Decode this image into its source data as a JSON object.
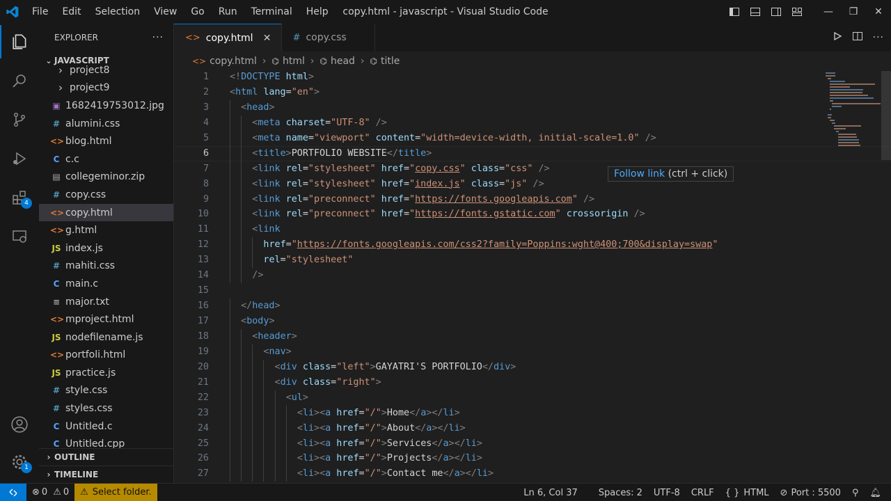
{
  "window": {
    "title": "copy.html - javascript - Visual Studio Code",
    "menus": [
      "File",
      "Edit",
      "Selection",
      "View",
      "Go",
      "Run",
      "Terminal",
      "Help"
    ]
  },
  "activity_bar": {
    "extensions_badge": "4",
    "manage_badge": "1"
  },
  "sidebar": {
    "header": "EXPLORER",
    "more": "···",
    "folder": "JAVASCRIPT",
    "items": [
      {
        "icon": "folder-chevron",
        "label": "project8",
        "glyph": "›",
        "color": "#cccccc"
      },
      {
        "icon": "folder-chevron",
        "label": "project9",
        "glyph": "›",
        "color": "#cccccc"
      },
      {
        "icon": "image-file-icon",
        "label": "1682419753012.jpg",
        "glyph": "▣",
        "color": "#a074c4"
      },
      {
        "icon": "css-file-icon",
        "label": "alumini.css",
        "glyph": "#",
        "color": "#519aba"
      },
      {
        "icon": "html-file-icon",
        "label": "blog.html",
        "glyph": "<>",
        "color": "#e37933"
      },
      {
        "icon": "c-file-icon",
        "label": "c.c",
        "glyph": "C",
        "color": "#599eff"
      },
      {
        "icon": "zip-file-icon",
        "label": "collegeminor.zip",
        "glyph": "▤",
        "color": "#aaaaaa"
      },
      {
        "icon": "css-file-icon",
        "label": "copy.css",
        "glyph": "#",
        "color": "#519aba"
      },
      {
        "icon": "html-file-icon",
        "label": "copy.html",
        "glyph": "<>",
        "color": "#e37933",
        "selected": true
      },
      {
        "icon": "html-file-icon",
        "label": "g.html",
        "glyph": "<>",
        "color": "#e37933"
      },
      {
        "icon": "js-file-icon",
        "label": "index.js",
        "glyph": "JS",
        "color": "#cbcb41"
      },
      {
        "icon": "css-file-icon",
        "label": "mahiti.css",
        "glyph": "#",
        "color": "#519aba"
      },
      {
        "icon": "c-file-icon",
        "label": "main.c",
        "glyph": "C",
        "color": "#599eff"
      },
      {
        "icon": "text-file-icon",
        "label": "major.txt",
        "glyph": "≡",
        "color": "#aaaaaa"
      },
      {
        "icon": "html-file-icon",
        "label": "mproject.html",
        "glyph": "<>",
        "color": "#e37933"
      },
      {
        "icon": "js-file-icon",
        "label": "nodefilename.js",
        "glyph": "JS",
        "color": "#cbcb41"
      },
      {
        "icon": "html-file-icon",
        "label": "portfoli.html",
        "glyph": "<>",
        "color": "#e37933"
      },
      {
        "icon": "js-file-icon",
        "label": "practice.js",
        "glyph": "JS",
        "color": "#cbcb41"
      },
      {
        "icon": "css-file-icon",
        "label": "style.css",
        "glyph": "#",
        "color": "#519aba"
      },
      {
        "icon": "css-file-icon",
        "label": "styles.css",
        "glyph": "#",
        "color": "#519aba"
      },
      {
        "icon": "c-file-icon",
        "label": "Untitled.c",
        "glyph": "C",
        "color": "#599eff"
      },
      {
        "icon": "c-file-icon",
        "label": "Untitled.cpp",
        "glyph": "C",
        "color": "#599eff"
      }
    ],
    "outline": "OUTLINE",
    "timeline": "TIMELINE"
  },
  "tabs": [
    {
      "label": "copy.html",
      "icon": "<>",
      "icon_color": "#e37933",
      "active": true,
      "close": "✕"
    },
    {
      "label": "copy.css",
      "icon": "#",
      "icon_color": "#519aba",
      "active": false,
      "close": ""
    }
  ],
  "breadcrumb": [
    "copy.html",
    "html",
    "head",
    "title"
  ],
  "hover": {
    "link": "Follow link",
    "hint": "(ctrl + click)"
  },
  "code_lines": [
    {
      "n": "1",
      "indent": 0,
      "tokens": [
        [
          "t",
          "<!"
        ],
        [
          "tag",
          "DOCTYPE"
        ],
        [
          "pl",
          " "
        ],
        [
          "at",
          "html"
        ],
        [
          "t",
          ">"
        ]
      ]
    },
    {
      "n": "2",
      "indent": 0,
      "tokens": [
        [
          "t",
          "<"
        ],
        [
          "tag",
          "html"
        ],
        [
          "pl",
          " "
        ],
        [
          "at",
          "lang"
        ],
        [
          "pl",
          "="
        ],
        [
          "str",
          "\"en\""
        ],
        [
          "t",
          ">"
        ]
      ]
    },
    {
      "n": "3",
      "indent": 1,
      "tokens": [
        [
          "t",
          "<"
        ],
        [
          "tag",
          "head"
        ],
        [
          "t",
          ">"
        ]
      ]
    },
    {
      "n": "4",
      "indent": 2,
      "tokens": [
        [
          "t",
          "<"
        ],
        [
          "tag",
          "meta"
        ],
        [
          "pl",
          " "
        ],
        [
          "at",
          "charset"
        ],
        [
          "pl",
          "="
        ],
        [
          "str",
          "\"UTF-8\""
        ],
        [
          "pl",
          " "
        ],
        [
          "t",
          "/>"
        ]
      ]
    },
    {
      "n": "5",
      "indent": 2,
      "tokens": [
        [
          "t",
          "<"
        ],
        [
          "tag",
          "meta"
        ],
        [
          "pl",
          " "
        ],
        [
          "at",
          "name"
        ],
        [
          "pl",
          "="
        ],
        [
          "str",
          "\"viewport\""
        ],
        [
          "pl",
          " "
        ],
        [
          "at",
          "content"
        ],
        [
          "pl",
          "="
        ],
        [
          "str",
          "\"width=device-width, initial-scale=1.0\""
        ],
        [
          "pl",
          " "
        ],
        [
          "t",
          "/>"
        ]
      ]
    },
    {
      "n": "6",
      "indent": 2,
      "cur": true,
      "tokens": [
        [
          "t",
          "<"
        ],
        [
          "tag",
          "title"
        ],
        [
          "t",
          ">"
        ],
        [
          "pl",
          "PORTFOLIO WEBSITE"
        ],
        [
          "t",
          "</"
        ],
        [
          "tag",
          "title"
        ],
        [
          "t",
          ">"
        ]
      ]
    },
    {
      "n": "7",
      "indent": 2,
      "tokens": [
        [
          "t",
          "<"
        ],
        [
          "tag",
          "link"
        ],
        [
          "pl",
          " "
        ],
        [
          "at",
          "rel"
        ],
        [
          "pl",
          "="
        ],
        [
          "str",
          "\"stylesheet\""
        ],
        [
          "pl",
          " "
        ],
        [
          "at",
          "href"
        ],
        [
          "pl",
          "="
        ],
        [
          "str",
          "\""
        ],
        [
          "lstr",
          "copy.css"
        ],
        [
          "str",
          "\""
        ],
        [
          "pl",
          " "
        ],
        [
          "at",
          "class"
        ],
        [
          "pl",
          "="
        ],
        [
          "str",
          "\"css\""
        ],
        [
          "pl",
          " "
        ],
        [
          "t",
          "/>"
        ]
      ]
    },
    {
      "n": "8",
      "indent": 2,
      "tokens": [
        [
          "t",
          "<"
        ],
        [
          "tag",
          "link"
        ],
        [
          "pl",
          " "
        ],
        [
          "at",
          "rel"
        ],
        [
          "pl",
          "="
        ],
        [
          "str",
          "\"stylesheet\""
        ],
        [
          "pl",
          " "
        ],
        [
          "at",
          "href"
        ],
        [
          "pl",
          "="
        ],
        [
          "str",
          "\""
        ],
        [
          "lstr",
          "index.js"
        ],
        [
          "str",
          "\""
        ],
        [
          "pl",
          " "
        ],
        [
          "at",
          "class"
        ],
        [
          "pl",
          "="
        ],
        [
          "str",
          "\"js\""
        ],
        [
          "pl",
          " "
        ],
        [
          "t",
          "/>"
        ]
      ]
    },
    {
      "n": "9",
      "indent": 2,
      "tokens": [
        [
          "t",
          "<"
        ],
        [
          "tag",
          "link"
        ],
        [
          "pl",
          " "
        ],
        [
          "at",
          "rel"
        ],
        [
          "pl",
          "="
        ],
        [
          "str",
          "\"preconnect\""
        ],
        [
          "pl",
          " "
        ],
        [
          "at",
          "href"
        ],
        [
          "pl",
          "="
        ],
        [
          "str",
          "\""
        ],
        [
          "lstr",
          "https://fonts.googleapis.com"
        ],
        [
          "str",
          "\""
        ],
        [
          "pl",
          " "
        ],
        [
          "t",
          "/>"
        ]
      ]
    },
    {
      "n": "10",
      "indent": 2,
      "tokens": [
        [
          "t",
          "<"
        ],
        [
          "tag",
          "link"
        ],
        [
          "pl",
          " "
        ],
        [
          "at",
          "rel"
        ],
        [
          "pl",
          "="
        ],
        [
          "str",
          "\"preconnect\""
        ],
        [
          "pl",
          " "
        ],
        [
          "at",
          "href"
        ],
        [
          "pl",
          "="
        ],
        [
          "str",
          "\""
        ],
        [
          "lstr",
          "https://fonts.gstatic.com"
        ],
        [
          "str",
          "\""
        ],
        [
          "pl",
          " "
        ],
        [
          "at",
          "crossorigin"
        ],
        [
          "pl",
          " "
        ],
        [
          "t",
          "/>"
        ]
      ]
    },
    {
      "n": "11",
      "indent": 2,
      "tokens": [
        [
          "t",
          "<"
        ],
        [
          "tag",
          "link"
        ]
      ]
    },
    {
      "n": "12",
      "indent": 3,
      "tokens": [
        [
          "at",
          "href"
        ],
        [
          "pl",
          "="
        ],
        [
          "str",
          "\""
        ],
        [
          "lstr",
          "https://fonts.googleapis.com/css2?family=Poppins:wght@400;700&display=swap"
        ],
        [
          "str",
          "\""
        ]
      ]
    },
    {
      "n": "13",
      "indent": 3,
      "tokens": [
        [
          "at",
          "rel"
        ],
        [
          "pl",
          "="
        ],
        [
          "str",
          "\"stylesheet\""
        ]
      ]
    },
    {
      "n": "14",
      "indent": 2,
      "tokens": [
        [
          "t",
          "/>"
        ]
      ]
    },
    {
      "n": "15",
      "indent": 0,
      "tokens": []
    },
    {
      "n": "16",
      "indent": 1,
      "tokens": [
        [
          "t",
          "</"
        ],
        [
          "tag",
          "head"
        ],
        [
          "t",
          ">"
        ]
      ]
    },
    {
      "n": "17",
      "indent": 1,
      "tokens": [
        [
          "t",
          "<"
        ],
        [
          "tag",
          "body"
        ],
        [
          "t",
          ">"
        ]
      ]
    },
    {
      "n": "18",
      "indent": 2,
      "tokens": [
        [
          "t",
          "<"
        ],
        [
          "tag",
          "header"
        ],
        [
          "t",
          ">"
        ]
      ]
    },
    {
      "n": "19",
      "indent": 3,
      "tokens": [
        [
          "t",
          "<"
        ],
        [
          "tag",
          "nav"
        ],
        [
          "t",
          ">"
        ]
      ]
    },
    {
      "n": "20",
      "indent": 4,
      "tokens": [
        [
          "t",
          "<"
        ],
        [
          "tag",
          "div"
        ],
        [
          "pl",
          " "
        ],
        [
          "at",
          "class"
        ],
        [
          "pl",
          "="
        ],
        [
          "str",
          "\"left\""
        ],
        [
          "t",
          ">"
        ],
        [
          "pl",
          "GAYATRI'S PORTFOLIO"
        ],
        [
          "t",
          "</"
        ],
        [
          "tag",
          "div"
        ],
        [
          "t",
          ">"
        ]
      ]
    },
    {
      "n": "21",
      "indent": 4,
      "tokens": [
        [
          "t",
          "<"
        ],
        [
          "tag",
          "div"
        ],
        [
          "pl",
          " "
        ],
        [
          "at",
          "class"
        ],
        [
          "pl",
          "="
        ],
        [
          "str",
          "\"right\""
        ],
        [
          "t",
          ">"
        ]
      ]
    },
    {
      "n": "22",
      "indent": 5,
      "tokens": [
        [
          "t",
          "<"
        ],
        [
          "tag",
          "ul"
        ],
        [
          "t",
          ">"
        ]
      ]
    },
    {
      "n": "23",
      "indent": 6,
      "tokens": [
        [
          "t",
          "<"
        ],
        [
          "tag",
          "li"
        ],
        [
          "t",
          "><"
        ],
        [
          "tag",
          "a"
        ],
        [
          "pl",
          " "
        ],
        [
          "at",
          "href"
        ],
        [
          "pl",
          "="
        ],
        [
          "str",
          "\"/\""
        ],
        [
          "t",
          ">"
        ],
        [
          "pl",
          "Home"
        ],
        [
          "t",
          "</"
        ],
        [
          "tag",
          "a"
        ],
        [
          "t",
          "></"
        ],
        [
          "tag",
          "li"
        ],
        [
          "t",
          ">"
        ]
      ]
    },
    {
      "n": "24",
      "indent": 6,
      "tokens": [
        [
          "t",
          "<"
        ],
        [
          "tag",
          "li"
        ],
        [
          "t",
          "><"
        ],
        [
          "tag",
          "a"
        ],
        [
          "pl",
          " "
        ],
        [
          "at",
          "href"
        ],
        [
          "pl",
          "="
        ],
        [
          "str",
          "\"/\""
        ],
        [
          "t",
          ">"
        ],
        [
          "pl",
          "About"
        ],
        [
          "t",
          "</"
        ],
        [
          "tag",
          "a"
        ],
        [
          "t",
          "></"
        ],
        [
          "tag",
          "li"
        ],
        [
          "t",
          ">"
        ]
      ]
    },
    {
      "n": "25",
      "indent": 6,
      "tokens": [
        [
          "t",
          "<"
        ],
        [
          "tag",
          "li"
        ],
        [
          "t",
          "><"
        ],
        [
          "tag",
          "a"
        ],
        [
          "pl",
          " "
        ],
        [
          "at",
          "href"
        ],
        [
          "pl",
          "="
        ],
        [
          "str",
          "\"/\""
        ],
        [
          "t",
          ">"
        ],
        [
          "pl",
          "Services"
        ],
        [
          "t",
          "</"
        ],
        [
          "tag",
          "a"
        ],
        [
          "t",
          "></"
        ],
        [
          "tag",
          "li"
        ],
        [
          "t",
          ">"
        ]
      ]
    },
    {
      "n": "26",
      "indent": 6,
      "tokens": [
        [
          "t",
          "<"
        ],
        [
          "tag",
          "li"
        ],
        [
          "t",
          "><"
        ],
        [
          "tag",
          "a"
        ],
        [
          "pl",
          " "
        ],
        [
          "at",
          "href"
        ],
        [
          "pl",
          "="
        ],
        [
          "str",
          "\"/\""
        ],
        [
          "t",
          ">"
        ],
        [
          "pl",
          "Projects"
        ],
        [
          "t",
          "</"
        ],
        [
          "tag",
          "a"
        ],
        [
          "t",
          "></"
        ],
        [
          "tag",
          "li"
        ],
        [
          "t",
          ">"
        ]
      ]
    },
    {
      "n": "27",
      "indent": 6,
      "tokens": [
        [
          "t",
          "<"
        ],
        [
          "tag",
          "li"
        ],
        [
          "t",
          "><"
        ],
        [
          "tag",
          "a"
        ],
        [
          "pl",
          " "
        ],
        [
          "at",
          "href"
        ],
        [
          "pl",
          "="
        ],
        [
          "str",
          "\"/\""
        ],
        [
          "t",
          ">"
        ],
        [
          "pl",
          "Contact me"
        ],
        [
          "t",
          "</"
        ],
        [
          "tag",
          "a"
        ],
        [
          "t",
          "></"
        ],
        [
          "tag",
          "li"
        ],
        [
          "t",
          ">"
        ]
      ]
    }
  ],
  "status": {
    "errors": "0",
    "warnings": "0",
    "select_folder": "Select folder.",
    "position": "Ln 6, Col 37",
    "spaces": "Spaces: 2",
    "encoding": "UTF-8",
    "eol": "CRLF",
    "language": "HTML",
    "port": "Port : 5500"
  },
  "colors": {
    "accent": "#0078d4",
    "warning_bg": "#b58a00"
  }
}
